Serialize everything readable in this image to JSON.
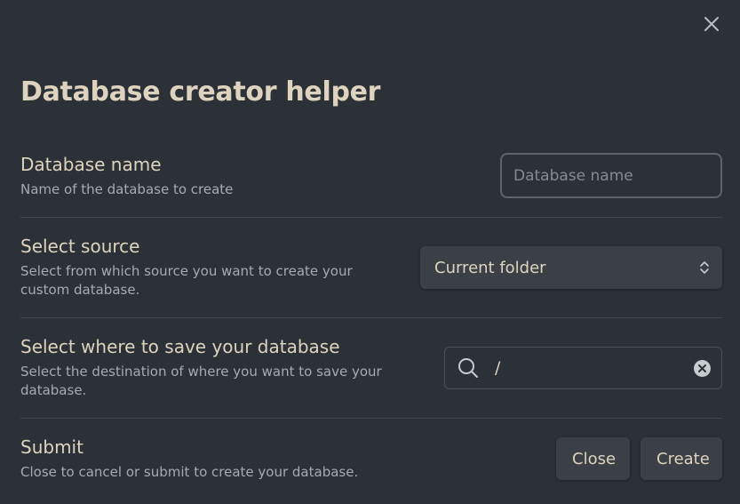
{
  "dialog": {
    "title": "Database creator helper",
    "close_icon": "close-icon"
  },
  "settings": {
    "name": {
      "label": "Database name",
      "description": "Name of the database to create",
      "placeholder": "Database name",
      "value": ""
    },
    "source": {
      "label": "Select source",
      "description": "Select from which source you want to create your custom database.",
      "selected": "Current folder",
      "icon": "chevron-up-down-icon"
    },
    "destination": {
      "label": "Select where to save your database",
      "description": "Select the destination of where you want to save your database.",
      "value": "/",
      "search_icon": "search-icon",
      "clear_icon": "clear-icon"
    },
    "submit": {
      "label": "Submit",
      "description": "Close to cancel or submit to create your database.",
      "close_label": "Close",
      "create_label": "Create"
    }
  },
  "colors": {
    "background": "#2c3137",
    "text": "#ddd3bf",
    "muted_text": "#a7aab0",
    "button_bg": "#3b4046",
    "divider": "#41464d"
  }
}
